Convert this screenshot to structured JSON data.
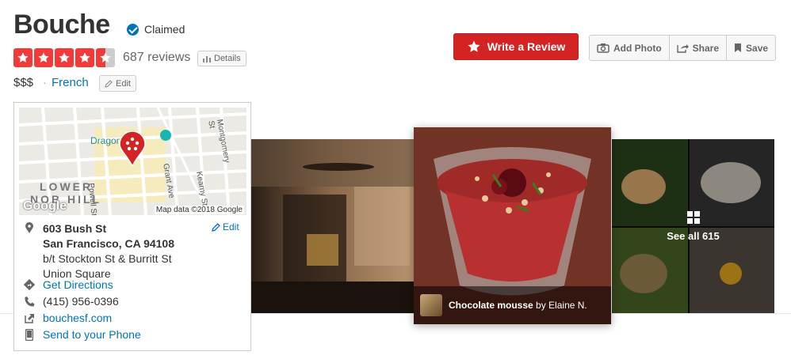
{
  "business": {
    "name": "Bouche",
    "claimed_label": "Claimed",
    "rating": 4.5,
    "review_count_label": "687 reviews",
    "details_label": "Details",
    "price": "$$$",
    "separator": "·",
    "category": "French",
    "edit_label": "Edit"
  },
  "actions": {
    "write_review": "Write a Review",
    "add_photo": "Add Photo",
    "share": "Share",
    "save": "Save"
  },
  "map": {
    "credit": "Map data ©2018 Google",
    "google_logo": "Google",
    "labels": {
      "dragon_gate": "Dragon Gate",
      "powell": "Powell St",
      "grant": "Grant Ave",
      "kearny": "Kearny St",
      "montgomery": "Montgomery St",
      "lower": "LOWER",
      "nob_hill": "NOB HILL"
    }
  },
  "location": {
    "street": "603 Bush St",
    "city_line": "San Francisco, CA 94108",
    "cross_streets": "b/t Stockton St & Burritt St",
    "neighborhood": "Union Square",
    "edit_label": "Edit",
    "directions": "Get Directions",
    "phone": "(415) 956-0396",
    "website": "bouchesf.com",
    "send_to_phone": "Send to your Phone"
  },
  "photos": {
    "caption_title": "Chocolate mousse",
    "caption_by": "by Elaine N.",
    "see_all": "See all 615"
  },
  "colors": {
    "brand_red": "#d32323",
    "star_red": "#f43939",
    "link_blue": "#0073bb"
  },
  "icons": [
    "check-circle-icon",
    "star-icon",
    "bar-chart-icon",
    "pencil-icon",
    "camera-icon",
    "share-icon",
    "bookmark-icon",
    "map-pin-icon",
    "directions-icon",
    "phone-icon",
    "external-link-icon",
    "mobile-phone-icon",
    "grid-icon"
  ]
}
